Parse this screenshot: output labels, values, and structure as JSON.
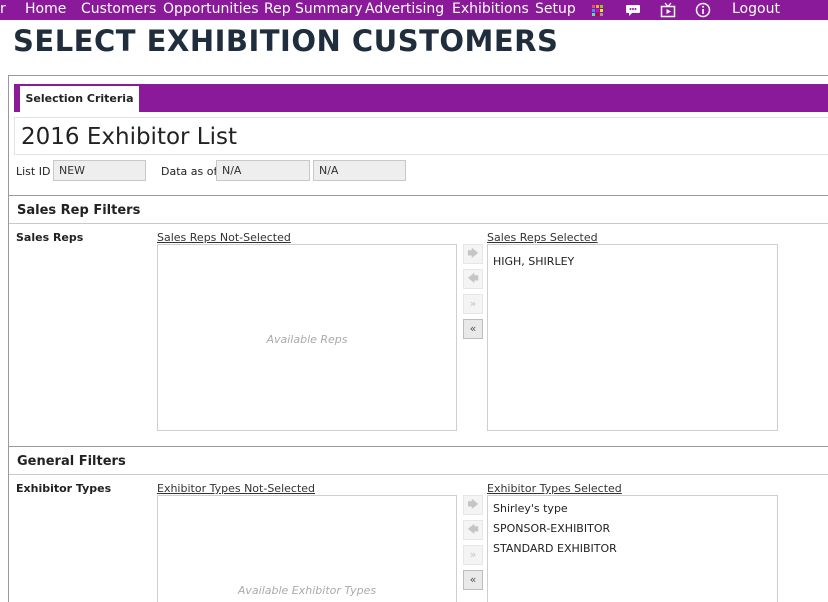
{
  "nav": {
    "items": [
      "r",
      "Home",
      "Customers",
      "Opportunities",
      "Rep Summary",
      "Advertising",
      "Exhibitions",
      "Setup"
    ],
    "icons": [
      "apps-grid-icon",
      "chat-icon",
      "media-icon",
      "info-icon"
    ],
    "logout": "Logout"
  },
  "page": {
    "title": "SELECT EXHIBITION CUSTOMERS"
  },
  "tabs": {
    "active": "Selection Criteria"
  },
  "list": {
    "title": "2016 Exhibitor List",
    "list_id_label": "List ID",
    "list_id_value": "NEW",
    "data_as_of_label": "Data as of",
    "data_as_of_value_1": "N/A",
    "data_as_of_value_2": "N/A"
  },
  "sales_rep_filters": {
    "section_title": "Sales Rep Filters",
    "field_label": "Sales Reps",
    "not_selected_header": "Sales Reps Not-Selected",
    "not_selected_placeholder": "Available Reps",
    "selected_header": "Sales Reps Selected",
    "selected_items": [
      "HIGH, SHIRLEY"
    ]
  },
  "general_filters": {
    "section_title": "General Filters",
    "field_label": "Exhibitor Types",
    "not_selected_header": "Exhibitor Types Not-Selected",
    "not_selected_placeholder": "Available Exhibitor Types",
    "selected_header": "Exhibitor Types Selected",
    "selected_items": [
      "Shirley's type",
      "SPONSOR-EXHIBITOR",
      "STANDARD EXHIBITOR"
    ]
  },
  "move_buttons": {
    "add_one": "🡆",
    "remove_one": "🡄",
    "add_all": "»",
    "remove_all": "«"
  },
  "colors": {
    "brand_purple": "#8b1a9a",
    "title_dark": "#1f2d3d"
  }
}
